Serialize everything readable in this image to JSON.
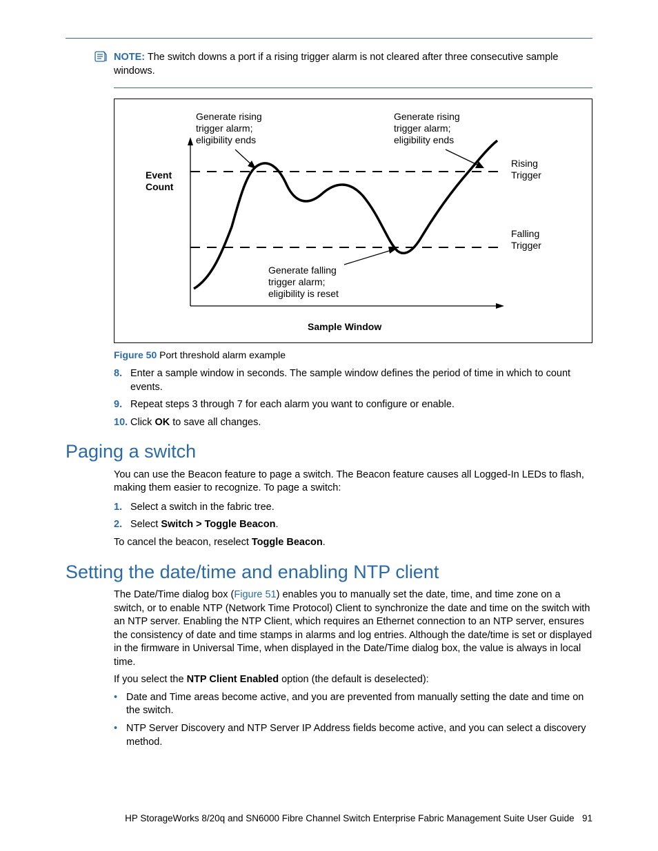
{
  "note": {
    "label": "NOTE:",
    "text": "The switch downs a port if a rising trigger alarm is not cleared after three consecutive sample windows."
  },
  "figure": {
    "labels": {
      "event_count_line1": "Event",
      "event_count_line2": "Count",
      "rising_left_line1": "Generate rising",
      "rising_left_line2": "trigger alarm;",
      "rising_left_line3": "eligibility ends",
      "rising_right_line1": "Generate rising",
      "rising_right_line2": "trigger alarm;",
      "rising_right_line3": "eligibility ends",
      "rising_trigger_line1": "Rising",
      "rising_trigger_line2": "Trigger",
      "falling_trigger_line1": "Falling",
      "falling_trigger_line2": "Trigger",
      "falling_center_line1": "Generate falling",
      "falling_center_line2": "trigger alarm;",
      "falling_center_line3": "eligibility is reset",
      "sample_window": "Sample Window"
    },
    "caption_label": "Figure 50",
    "caption_text": "Port threshold alarm example"
  },
  "steps_after_figure": [
    {
      "num": "8.",
      "html": "Enter a sample window in seconds. The sample window defines the period of time in which to count events."
    },
    {
      "num": "9.",
      "html": "Repeat steps 3 through 7 for each alarm you want to configure or enable."
    },
    {
      "num": "10.",
      "html_prefix": "Click ",
      "bold": "OK",
      "html_suffix": " to save all changes."
    }
  ],
  "section_paging": {
    "heading": "Paging a switch",
    "intro": "You can use the Beacon feature to page a switch. The Beacon feature causes all Logged-In LEDs to flash, making them easier to recognize. To page a switch:",
    "steps": [
      {
        "num": "1.",
        "text": "Select a switch in the fabric tree."
      },
      {
        "num": "2.",
        "prefix": "Select ",
        "bold": "Switch > Toggle Beacon",
        "suffix": "."
      }
    ],
    "outro_prefix": "To cancel the beacon, reselect ",
    "outro_bold": "Toggle Beacon",
    "outro_suffix": "."
  },
  "section_ntp": {
    "heading": "Setting the date/time and enabling NTP client",
    "p1_prefix": "The Date/Time dialog box (",
    "p1_link": "Figure 51",
    "p1_suffix": ") enables you to manually set the date, time, and time zone on a switch, or to enable NTP (Network Time Protocol) Client to synchronize the date and time on the switch with an NTP server. Enabling the NTP Client, which requires an Ethernet connection to an NTP server, ensures the consistency of date and time stamps in alarms and log entries. Although the date/time is set or displayed in the firmware in Universal Time, when displayed in the Date/Time dialog box, the value is always in local time.",
    "p2_prefix": "If you select the ",
    "p2_bold": "NTP Client Enabled",
    "p2_suffix": " option (the default is deselected):",
    "bullets": [
      "Date and Time areas become active, and you are prevented from manually setting the date and time on the switch.",
      "NTP Server Discovery and NTP Server IP Address fields become active, and you can select a discovery method."
    ]
  },
  "footer": {
    "text": "HP StorageWorks 8/20q and SN6000 Fibre Channel Switch Enterprise Fabric Management Suite User Guide",
    "page": "91"
  },
  "chart_data": {
    "type": "line",
    "title": "Port threshold alarm example",
    "xlabel": "Sample Window",
    "ylabel": "Event Count",
    "annotations": [
      "Generate rising trigger alarm; eligibility ends",
      "Generate falling trigger alarm; eligibility is reset",
      "Rising Trigger",
      "Falling Trigger"
    ],
    "thresholds": {
      "rising": 100,
      "falling": 50
    },
    "series": [
      {
        "name": "event_count",
        "x": [
          0,
          10,
          20,
          27,
          32,
          38,
          45,
          52,
          58,
          65,
          72,
          78,
          85,
          92,
          100
        ],
        "y": [
          30,
          38,
          55,
          80,
          103,
          95,
          85,
          98,
          92,
          70,
          48,
          55,
          70,
          90,
          108
        ]
      }
    ]
  }
}
